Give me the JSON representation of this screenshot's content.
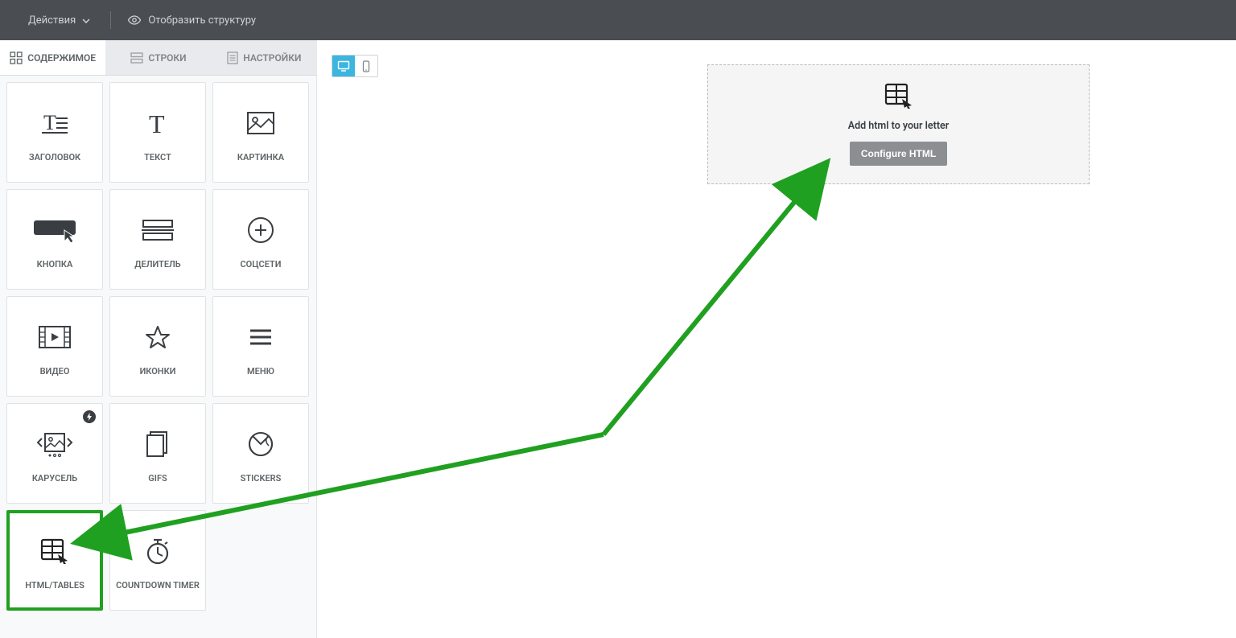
{
  "topbar": {
    "actions_label": "Действия",
    "structure_label": "Отобразить структуру"
  },
  "tabs": {
    "content": "СОДЕРЖИМОЕ",
    "rows": "СТРОКИ",
    "settings": "НАСТРОЙКИ"
  },
  "blocks": {
    "heading": "ЗАГОЛОВОК",
    "text": "ТЕКСТ",
    "image": "КАРТИНКА",
    "button": "КНОПКА",
    "divider": "ДЕЛИТЕЛЬ",
    "social": "СОЦСЕТИ",
    "video": "ВИДЕО",
    "icons": "ИКОНКИ",
    "menu": "МЕНЮ",
    "carousel": "КАРУСЕЛЬ",
    "gifs": "GIFS",
    "stickers": "STICKERS",
    "html": "HTML/TABLES",
    "countdown": "COUNTDOWN TIMER"
  },
  "dropzone": {
    "text": "Add html to your letter",
    "button": "Configure HTML"
  }
}
